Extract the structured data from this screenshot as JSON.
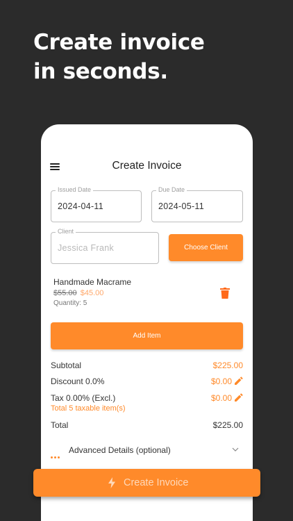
{
  "headline": {
    "line1": "Create invoice",
    "line2": "in seconds."
  },
  "app": {
    "title": "Create Invoice",
    "menu_icon": "hamburger-menu-icon"
  },
  "form": {
    "issued_date": {
      "label": "Issued Date",
      "value": "2024-04-11"
    },
    "due_date": {
      "label": "Due Date",
      "value": "2024-05-11"
    },
    "client": {
      "label": "Client",
      "placeholder": "Jessica Frank"
    },
    "choose_client_label": "Choose Client"
  },
  "items": [
    {
      "name": "Handmade Macrame",
      "old_price": "$55.00",
      "new_price": "$45.00",
      "quantity": "Quantity: 5"
    }
  ],
  "add_item_label": "Add Item",
  "summary": {
    "subtotal_label": "Subtotal",
    "subtotal_value": "$225.00",
    "discount_label": "Discount 0.0%",
    "discount_value": "$0.00",
    "tax_label": "Tax 0.00% (Excl.)",
    "tax_value": "$0.00",
    "tax_note": "Total 5 taxable item(s)",
    "total_label": "Total",
    "total_value": "$225.00"
  },
  "advanced_label": "Advanced Details (optional)",
  "create_button_label": "Create Invoice",
  "colors": {
    "accent": "#ff8a2a",
    "background": "#2b2b2b",
    "card": "#ffffff"
  }
}
